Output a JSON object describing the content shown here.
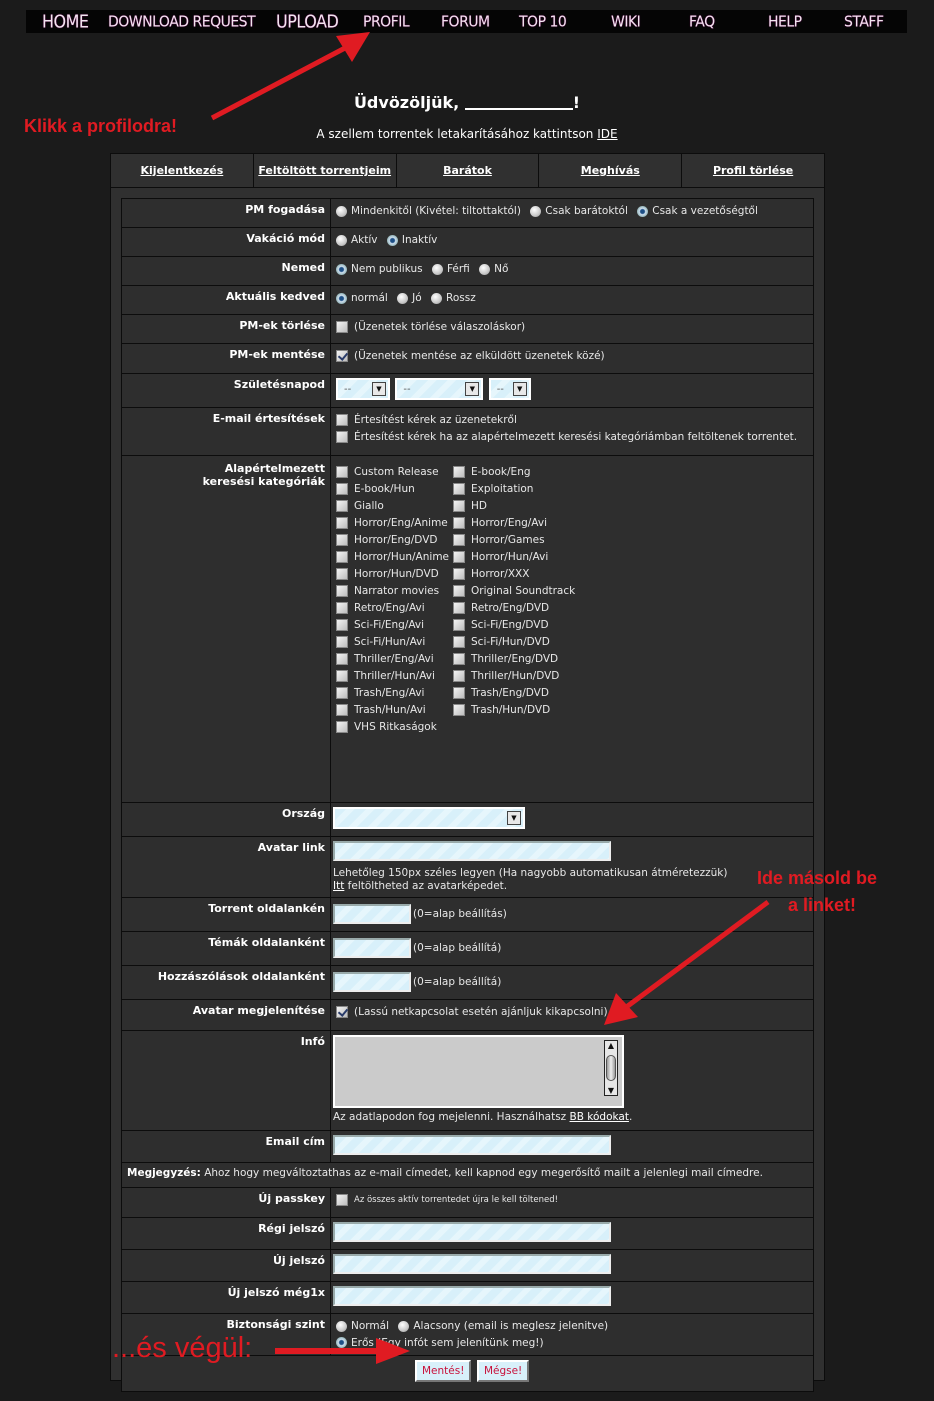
{
  "nav": [
    "HOME",
    "DOWNLOAD REQUEST",
    "UPLOAD",
    "PROFIL",
    "FORUM",
    "TOP 10",
    "WIKI",
    "FAQ",
    "HELP",
    "STAFF"
  ],
  "greeting": {
    "prefix": "Üdvözöljük,",
    "suffix": "!"
  },
  "ghost_line": {
    "text": "A szellem torrentek letakarításához kattintson ",
    "link": "IDE"
  },
  "tabs": [
    "Kijelentkezés",
    "Feltöltött torrentjeim",
    "Barátok",
    "Meghívás",
    "Profil törlése"
  ],
  "form": {
    "pm_receive": {
      "label": "PM fogadása",
      "options": [
        "Mindenkitől (Kivétel: tiltottaktól)",
        "Csak barátoktól",
        "Csak a vezetőségtől"
      ],
      "selected": 2
    },
    "vacation": {
      "label": "Vakáció mód",
      "options": [
        "Aktív",
        "Inaktív"
      ],
      "selected": 1
    },
    "gender": {
      "label": "Nemed",
      "options": [
        "Nem publikus",
        "Férfi",
        "Nő"
      ],
      "selected": 0
    },
    "mood": {
      "label": "Aktuális kedved",
      "options": [
        "normál",
        "Jó",
        "Rossz"
      ],
      "selected": 0
    },
    "pm_delete": {
      "label": "PM-ek törlése",
      "text": "(Üzenetek törlése válaszoláskor)",
      "checked": false
    },
    "pm_save": {
      "label": "PM-ek mentése",
      "text": "(Üzenetek mentése az elküldött üzenetek közé)",
      "checked": true
    },
    "birthday": {
      "label": "Születésnapod",
      "year": "--",
      "month": "--",
      "day": "--"
    },
    "email_notify": {
      "label": "E-mail értesítések",
      "options": [
        "Értesítést kérek az üzenetekről",
        "Értesítést kérek ha az alapértelmezett keresési kategóriámban feltöltenek torrentet."
      ]
    },
    "categories": {
      "label_line1": "Alapértelmezett",
      "label_line2": "keresési kategóriák",
      "items": [
        "Custom Release",
        "E-book/Eng",
        "E-book/Hun",
        "Exploitation",
        "Giallo",
        "HD",
        "Horror/Eng/Anime",
        "Horror/Eng/Avi",
        "Horror/Eng/DVD",
        "Horror/Games",
        "Horror/Hun/Anime",
        "Horror/Hun/Avi",
        "Horror/Hun/DVD",
        "Horror/XXX",
        "Narrator movies",
        "Original Soundtrack",
        "Retro/Eng/Avi",
        "Retro/Eng/DVD",
        "Sci-Fi/Eng/Avi",
        "Sci-Fi/Eng/DVD",
        "Sci-Fi/Hun/Avi",
        "Sci-Fi/Hun/DVD",
        "Thriller/Eng/Avi",
        "Thriller/Eng/DVD",
        "Thriller/Hun/Avi",
        "Thriller/Hun/DVD",
        "Trash/Eng/Avi",
        "Trash/Eng/DVD",
        "Trash/Hun/Avi",
        "Trash/Hun/DVD",
        "VHS Ritkaságok"
      ]
    },
    "country": {
      "label": "Ország",
      "value": ""
    },
    "avatar_link": {
      "label": "Avatar link",
      "value": "",
      "hint1": "Lehetőleg 150px széles legyen (Ha nagyobb automatikusan átméretezzük)",
      "hint2_link": "Itt",
      "hint2_rest": " feltöltheted az avatarképedet."
    },
    "torrents_per_page": {
      "label": "Torrent oldalankén",
      "value": "",
      "hint": "(0=alap beállítás)"
    },
    "topics_per_page": {
      "label": "Témák oldalanként",
      "value": "",
      "hint": "(0=alap beállítá)"
    },
    "posts_per_page": {
      "label": "Hozzászólások oldalanként",
      "value": "",
      "hint": "(0=alap beállítá)"
    },
    "show_avatar": {
      "label": "Avatar megjelenítése",
      "text": "(Lassú netkapcsolat esetén ajánljuk kikapcsolni)",
      "checked": true
    },
    "info": {
      "label": "Infó",
      "value": "",
      "hint": "Az adatlapodon fog mejelenni. Használhatsz ",
      "hint_link": "BB kódokat",
      "hint_end": "."
    },
    "email": {
      "label": "Email cím",
      "value": ""
    },
    "note": {
      "bold": "Megjegyzés:",
      "text": " Ahoz hogy megváltoztathas az e-mail címedet, kell kapnod egy megerősítő mailt a jelenlegi mail címedre."
    },
    "new_passkey": {
      "label": "Új passkey",
      "text": "Az összes aktív torrentedet újra le kell töltened!",
      "checked": false
    },
    "old_password": {
      "label": "Régi jelszó",
      "value": ""
    },
    "new_password": {
      "label": "Új jelszó",
      "value": ""
    },
    "new_password_again": {
      "label": "Új jelszó még1x",
      "value": ""
    },
    "security": {
      "label": "Biztonsági szint",
      "options": [
        "Normál",
        "Alacsony (email is meglesz jelenitve)",
        "Erős (Egy infót sem jelenítünk meg!)"
      ],
      "selected": 2
    },
    "save_label": "Mentés!",
    "cancel_label": "Mégse!"
  },
  "annotations": {
    "click_profile": "Klikk a profilodra!",
    "paste_link_1": "Ide másold be",
    "paste_link_2": "a linket!",
    "finally": "...és végül:",
    "color": "#e01b22"
  }
}
